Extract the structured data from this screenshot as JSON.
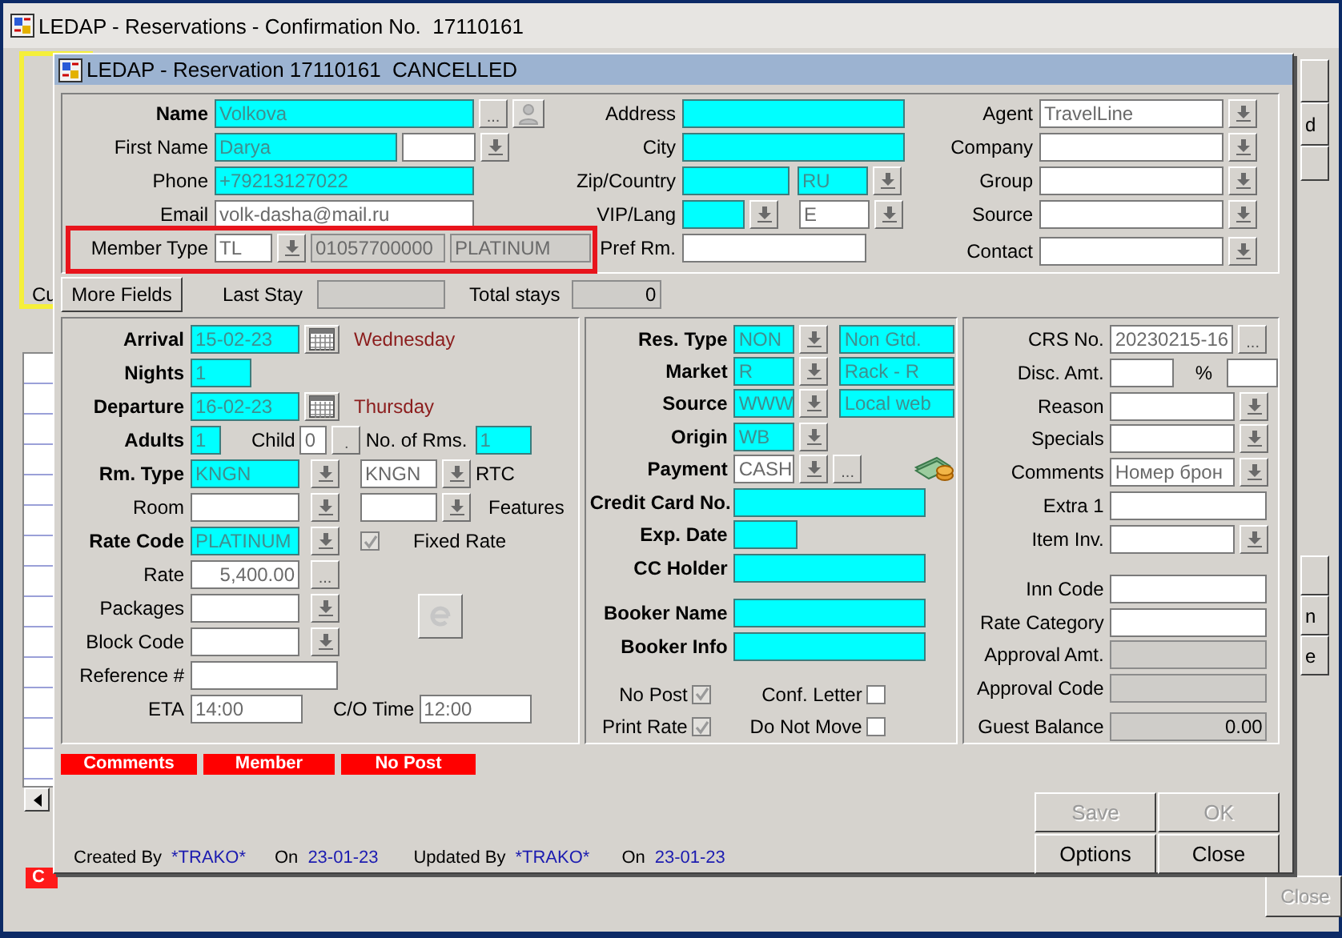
{
  "outer_window": {
    "title": "LEDAP - Reservations - Confirmation No.  17110161",
    "items": [
      {
        "kind": "label",
        "text": "Cu"
      },
      {
        "kind": "button"
      },
      {
        "kind": "button",
        "label": "d",
        "disabled": false
      },
      {
        "kind": "button"
      },
      {
        "kind": "button"
      },
      {
        "kind": "button",
        "label": "n",
        "disabled": false
      },
      {
        "kind": "button",
        "label": "e",
        "disabled": false
      },
      {
        "kind": "button",
        "label": "Close",
        "disabled": true
      },
      {
        "kind": "tag",
        "text": "C"
      }
    ]
  },
  "dialog": {
    "title": "LEDAP - Reservation 17110161  CANCELLED",
    "guest": {
      "columns": [
        {
          "rows": [
            {
              "label": "Name",
              "bold": true,
              "items": [
                {
                  "kind": "field",
                  "required": true,
                  "readonly": false,
                  "value": "Volkova"
                },
                {
                  "kind": "ellipsis",
                  "label": "..."
                },
                {
                  "kind": "profile_button",
                  "disabled": true
                }
              ]
            },
            {
              "label": "First Name",
              "bold": false,
              "items": [
                {
                  "kind": "field",
                  "required": true,
                  "readonly": false,
                  "value": "Darya"
                },
                {
                  "kind": "field",
                  "required": false,
                  "readonly": false
                },
                {
                  "kind": "dropdown"
                }
              ]
            },
            {
              "label": "Phone",
              "bold": false,
              "items": [
                {
                  "kind": "field",
                  "required": true,
                  "readonly": false,
                  "value": "+79213127022"
                }
              ]
            },
            {
              "label": "Email",
              "bold": false,
              "items": [
                {
                  "kind": "field",
                  "required": false,
                  "readonly": false,
                  "value": "volk-dasha@mail.ru"
                }
              ]
            },
            {
              "label": "Member Type",
              "bold": false,
              "items": [
                {
                  "kind": "field",
                  "required": false,
                  "readonly": false,
                  "value": "TL"
                },
                {
                  "kind": "dropdown"
                },
                {
                  "kind": "field",
                  "required": false,
                  "readonly": true,
                  "value": "01057700000"
                },
                {
                  "kind": "field",
                  "required": false,
                  "readonly": true,
                  "value": "PLATINUM"
                }
              ]
            }
          ]
        },
        {
          "rows": [
            {
              "label": "Address",
              "bold": false,
              "items": [
                {
                  "kind": "field",
                  "required": true,
                  "readonly": false
                }
              ]
            },
            {
              "label": "City",
              "bold": false,
              "items": [
                {
                  "kind": "field",
                  "required": true,
                  "readonly": false
                }
              ]
            },
            {
              "label": "Zip/Country",
              "bold": false,
              "items": [
                {
                  "kind": "field",
                  "required": true,
                  "readonly": false
                },
                {
                  "kind": "field",
                  "required": true,
                  "readonly": false,
                  "value": "RU"
                },
                {
                  "kind": "dropdown"
                }
              ]
            },
            {
              "label": "VIP/Lang",
              "bold": false,
              "items": [
                {
                  "kind": "field",
                  "required": true,
                  "readonly": false
                },
                {
                  "kind": "dropdown"
                },
                {
                  "kind": "field",
                  "required": false,
                  "readonly": false,
                  "value": "E"
                },
                {
                  "kind": "dropdown"
                }
              ]
            },
            {
              "label": "Pref Rm.",
              "bold": false,
              "items": [
                {
                  "kind": "field",
                  "required": false,
                  "readonly": false
                }
              ]
            }
          ]
        },
        {
          "rows": [
            {
              "label": "Agent",
              "bold": false,
              "items": [
                {
                  "kind": "field",
                  "required": false,
                  "readonly": false,
                  "value": "TravelLine"
                },
                {
                  "kind": "dropdown"
                }
              ]
            },
            {
              "label": "Company",
              "bold": false,
              "items": [
                {
                  "kind": "field",
                  "required": false,
                  "readonly": false
                },
                {
                  "kind": "dropdown"
                }
              ]
            },
            {
              "label": "Group",
              "bold": false,
              "items": [
                {
                  "kind": "field",
                  "required": false,
                  "readonly": false
                },
                {
                  "kind": "dropdown"
                }
              ]
            },
            {
              "label": "Source",
              "bold": false,
              "items": [
                {
                  "kind": "field",
                  "required": false,
                  "readonly": false
                },
                {
                  "kind": "dropdown"
                }
              ]
            },
            {
              "label": "Contact",
              "bold": false,
              "items": [
                {
                  "kind": "field",
                  "required": false,
                  "readonly": false
                },
                {
                  "kind": "dropdown"
                }
              ]
            }
          ]
        }
      ]
    },
    "summary": {
      "button": "More Fields",
      "items": [
        {
          "kind": "label",
          "text": "Last Stay"
        },
        {
          "kind": "field",
          "required": false,
          "readonly": true
        },
        {
          "kind": "label",
          "text": "Total stays"
        },
        {
          "kind": "field",
          "required": false,
          "readonly": true,
          "value": "0"
        }
      ]
    },
    "panels": [
      {
        "rows": [
          {
            "label": "Arrival",
            "bold": true,
            "items": [
              {
                "kind": "field",
                "required": true,
                "readonly": false,
                "value": "15-02-23"
              },
              {
                "kind": "calendar"
              },
              {
                "kind": "note",
                "text": "Wednesday"
              }
            ]
          },
          {
            "label": "Nights",
            "bold": true,
            "items": [
              {
                "kind": "field",
                "required": true,
                "readonly": false,
                "value": "1"
              }
            ]
          },
          {
            "label": "Departure",
            "bold": true,
            "items": [
              {
                "kind": "field",
                "required": true,
                "readonly": false,
                "value": "16-02-23"
              },
              {
                "kind": "calendar"
              },
              {
                "kind": "note",
                "text": "Thursday"
              }
            ]
          },
          {
            "label": "Adults",
            "bold": true,
            "items": [
              {
                "kind": "field",
                "required": true,
                "readonly": false,
                "value": "1"
              },
              {
                "kind": "label",
                "text": "Child"
              },
              {
                "kind": "field",
                "required": false,
                "readonly": false,
                "value": "0"
              },
              {
                "kind": "ellipsis",
                "label": "."
              },
              {
                "kind": "label",
                "text": "No. of Rms."
              },
              {
                "kind": "field",
                "required": true,
                "readonly": false,
                "value": "1"
              }
            ]
          },
          {
            "label": "Rm. Type",
            "bold": true,
            "items": [
              {
                "kind": "field",
                "required": true,
                "readonly": false,
                "value": "KNGN"
              },
              {
                "kind": "dropdown"
              },
              {
                "kind": "field",
                "required": false,
                "readonly": false,
                "value": "KNGN"
              },
              {
                "kind": "dropdown"
              },
              {
                "kind": "label",
                "text": "RTC"
              }
            ]
          },
          {
            "label": "Room",
            "bold": false,
            "items": [
              {
                "kind": "field",
                "required": false,
                "readonly": false
              },
              {
                "kind": "dropdown"
              },
              {
                "kind": "field",
                "required": false,
                "readonly": false
              },
              {
                "kind": "dropdown"
              },
              {
                "kind": "label",
                "text": "Features"
              }
            ]
          },
          {
            "label": "Rate Code",
            "bold": true,
            "items": [
              {
                "kind": "field",
                "required": true,
                "readonly": false,
                "value": "PLATINUM"
              },
              {
                "kind": "dropdown"
              },
              {
                "kind": "check",
                "checked": true,
                "disabled": true
              },
              {
                "kind": "label",
                "text": "Fixed Rate"
              }
            ]
          },
          {
            "label": "Rate",
            "bold": false,
            "items": [
              {
                "kind": "field",
                "required": false,
                "readonly": false,
                "value": "5,400.00"
              },
              {
                "kind": "ellipsis",
                "label": "..."
              }
            ]
          },
          {
            "label": "Packages",
            "bold": false,
            "items": [
              {
                "kind": "field",
                "required": false,
                "readonly": false
              },
              {
                "kind": "dropdown"
              },
              {
                "kind": "round_button",
                "disabled": true
              }
            ]
          },
          {
            "label": "Block Code",
            "bold": false,
            "items": [
              {
                "kind": "field",
                "required": false,
                "readonly": false
              },
              {
                "kind": "dropdown"
              }
            ]
          },
          {
            "label": "Reference #",
            "bold": false,
            "items": [
              {
                "kind": "field",
                "required": false,
                "readonly": false
              }
            ]
          },
          {
            "label": "ETA",
            "bold": false,
            "items": [
              {
                "kind": "field",
                "required": false,
                "readonly": false,
                "value": "14:00"
              },
              {
                "kind": "label",
                "text": "C/O Time"
              },
              {
                "kind": "field",
                "required": false,
                "readonly": false,
                "value": "12:00"
              }
            ]
          }
        ]
      },
      {
        "rows": [
          {
            "label": "Res. Type",
            "bold": true,
            "items": [
              {
                "kind": "field",
                "required": true,
                "readonly": false,
                "value": "NON"
              },
              {
                "kind": "dropdown"
              },
              {
                "kind": "field",
                "required": true,
                "readonly": false,
                "value": "Non Gtd."
              }
            ]
          },
          {
            "label": "Market",
            "bold": true,
            "items": [
              {
                "kind": "field",
                "required": true,
                "readonly": false,
                "value": "R"
              },
              {
                "kind": "dropdown"
              },
              {
                "kind": "field",
                "required": true,
                "readonly": false,
                "value": "Rack - R"
              }
            ]
          },
          {
            "label": "Source",
            "bold": true,
            "items": [
              {
                "kind": "field",
                "required": true,
                "readonly": false,
                "value": "WWW"
              },
              {
                "kind": "dropdown"
              },
              {
                "kind": "field",
                "required": true,
                "readonly": false,
                "value": "Local web"
              }
            ]
          },
          {
            "label": "Origin",
            "bold": true,
            "items": [
              {
                "kind": "field",
                "required": true,
                "readonly": false,
                "value": "WB"
              },
              {
                "kind": "dropdown"
              }
            ]
          },
          {
            "label": "Payment",
            "bold": true,
            "items": [
              {
                "kind": "field",
                "required": false,
                "readonly": false,
                "value": "CASH"
              },
              {
                "kind": "dropdown"
              },
              {
                "kind": "ellipsis",
                "label": "..."
              },
              {
                "kind": "cash_icon"
              }
            ]
          },
          {
            "label": "Credit Card No.",
            "bold": true,
            "items": [
              {
                "kind": "field",
                "required": true,
                "readonly": false
              }
            ]
          },
          {
            "label": "Exp. Date",
            "bold": true,
            "items": [
              {
                "kind": "field",
                "required": true,
                "readonly": false
              }
            ]
          },
          {
            "label": "CC Holder",
            "bold": true,
            "items": [
              {
                "kind": "field",
                "required": true,
                "readonly": false
              }
            ]
          },
          {
            "label": "Booker Name",
            "bold": true,
            "items": [
              {
                "kind": "field",
                "required": true,
                "readonly": false
              }
            ]
          },
          {
            "label": "Booker Info",
            "bold": true,
            "items": [
              {
                "kind": "field",
                "required": true,
                "readonly": false
              }
            ]
          },
          {
            "items": [
              {
                "kind": "check",
                "label": "No Post",
                "checked": true,
                "disabled": true
              },
              {
                "kind": "check",
                "label": "Conf. Letter",
                "checked": false,
                "disabled": false
              }
            ]
          },
          {
            "items": [
              {
                "kind": "check",
                "label": "Print Rate",
                "checked": true,
                "disabled": true
              },
              {
                "kind": "check",
                "label": "Do Not Move",
                "checked": false,
                "disabled": false
              }
            ]
          }
        ]
      },
      {
        "rows": [
          {
            "label": "CRS No.",
            "bold": false,
            "items": [
              {
                "kind": "field",
                "required": false,
                "readonly": false,
                "value": "20230215-16"
              },
              {
                "kind": "ellipsis",
                "label": "..."
              }
            ]
          },
          {
            "label": "Disc. Amt.",
            "bold": false,
            "items": [
              {
                "kind": "field",
                "required": false,
                "readonly": false
              },
              {
                "kind": "label",
                "text": "%"
              },
              {
                "kind": "field",
                "required": false,
                "readonly": false
              }
            ]
          },
          {
            "label": "Reason",
            "bold": false,
            "items": [
              {
                "kind": "field",
                "required": false,
                "readonly": false
              },
              {
                "kind": "dropdown"
              }
            ]
          },
          {
            "label": "Specials",
            "bold": false,
            "items": [
              {
                "kind": "field",
                "required": false,
                "readonly": false
              },
              {
                "kind": "dropdown"
              }
            ]
          },
          {
            "label": "Comments",
            "bold": false,
            "items": [
              {
                "kind": "field",
                "required": false,
                "readonly": false,
                "value": "Номер брон"
              },
              {
                "kind": "dropdown"
              }
            ]
          },
          {
            "label": "Extra 1",
            "bold": false,
            "items": [
              {
                "kind": "field",
                "required": false,
                "readonly": false
              }
            ]
          },
          {
            "label": "Item Inv.",
            "bold": false,
            "items": [
              {
                "kind": "field",
                "required": false,
                "readonly": false
              },
              {
                "kind": "dropdown"
              }
            ]
          },
          {
            "label": "Inn Code",
            "bold": false,
            "items": [
              {
                "kind": "field",
                "required": false,
                "readonly": false
              }
            ]
          },
          {
            "label": "Rate Category",
            "bold": false,
            "items": [
              {
                "kind": "field",
                "required": false,
                "readonly": false
              }
            ]
          },
          {
            "label": "Approval Amt.",
            "bold": false,
            "items": [
              {
                "kind": "field",
                "required": false,
                "readonly": true
              }
            ]
          },
          {
            "label": "Approval Code",
            "bold": false,
            "items": [
              {
                "kind": "field",
                "required": false,
                "readonly": true
              }
            ]
          },
          {
            "label": "Guest Balance",
            "bold": false,
            "items": [
              {
                "kind": "field",
                "required": false,
                "readonly": true,
                "value": "0.00"
              }
            ]
          }
        ]
      }
    ],
    "alerts": [
      "Comments",
      "Member",
      "No Post"
    ],
    "audit": [
      {
        "label": "Created By",
        "value": "*TRAKO*"
      },
      {
        "label": "On",
        "value": "23-01-23"
      },
      {
        "label": "Updated By",
        "value": "*TRAKO*"
      },
      {
        "label": "On",
        "value": "23-01-23"
      }
    ],
    "buttons": [
      {
        "label": "Save",
        "disabled": true
      },
      {
        "label": "OK",
        "disabled": true
      },
      {
        "label": "Options",
        "disabled": false
      },
      {
        "label": "Close",
        "disabled": false
      }
    ]
  }
}
